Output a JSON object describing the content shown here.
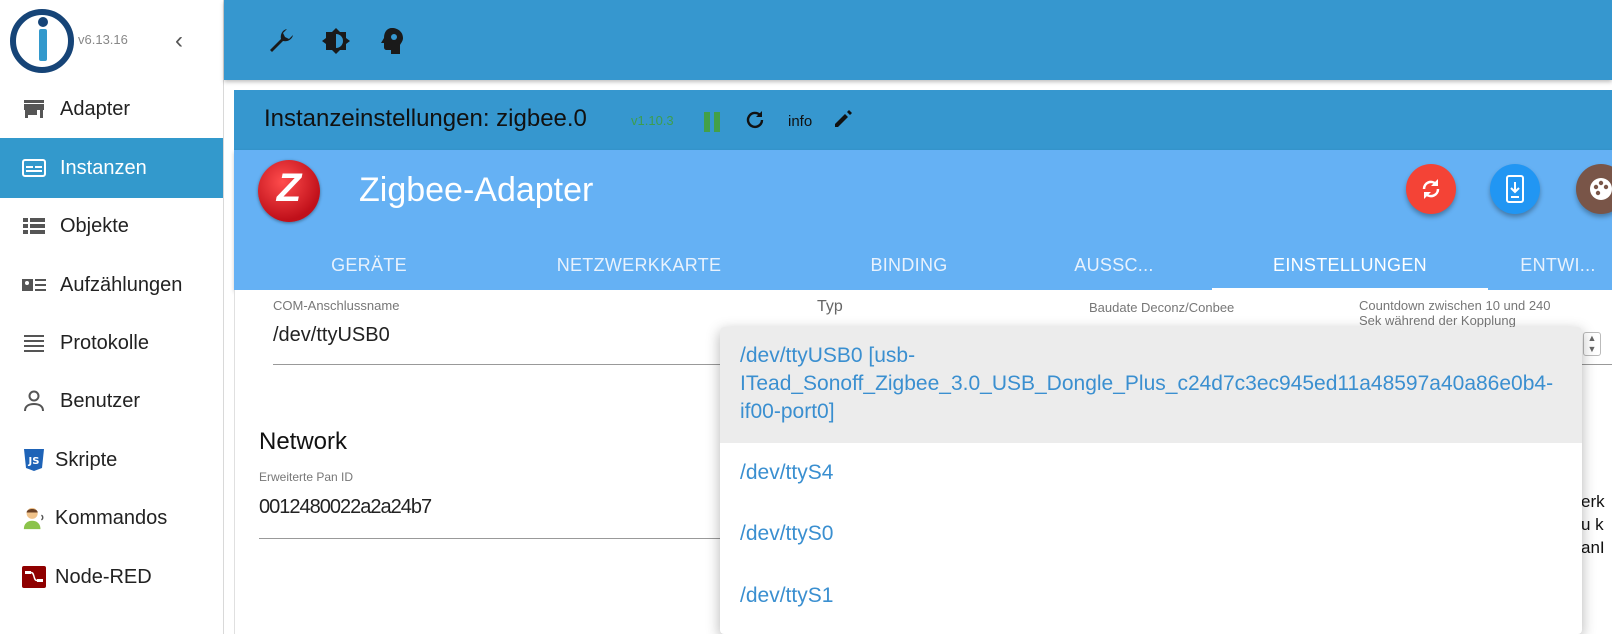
{
  "sidebar": {
    "version": "v6.13.16",
    "items": [
      {
        "label": "Adapter",
        "icon": "store-icon",
        "active": false
      },
      {
        "label": "Instanzen",
        "icon": "instances-icon",
        "active": true
      },
      {
        "label": "Objekte",
        "icon": "list-icon",
        "active": false
      },
      {
        "label": "Aufzählungen",
        "icon": "enum-icon",
        "active": false
      },
      {
        "label": "Protokolle",
        "icon": "log-icon",
        "active": false
      },
      {
        "label": "Benutzer",
        "icon": "user-icon",
        "active": false
      },
      {
        "label": "Skripte",
        "icon": "js-icon",
        "active": false
      },
      {
        "label": "Kommandos",
        "icon": "avatar-icon",
        "active": false
      },
      {
        "label": "Node-RED",
        "icon": "node-red-icon",
        "active": false
      }
    ]
  },
  "toolbar": {
    "icons": [
      "wrench-icon",
      "brightness-icon",
      "expert-mode-icon"
    ]
  },
  "instance": {
    "title": "Instanzeinstellungen: zigbee.0",
    "version": "v1.10.3",
    "info_label": "info"
  },
  "adapter": {
    "title": "Zigbee-Adapter",
    "tabs": [
      "GERÄTE",
      "NETZWERKKARTE",
      "BINDING",
      "AUSSC...",
      "EINSTELLUNGEN",
      "ENTWI..."
    ],
    "active_tab": "EINSTELLUNGEN"
  },
  "form": {
    "com_label": "COM-Anschlussname",
    "com_value": "/dev/ttyUSB0",
    "typ_label": "Typ",
    "baud_label": "Baudate Deconz/Conbee",
    "countdown_label": "Countdown zwischen 10 und 240 Sek während der Kopplung",
    "network_heading": "Network",
    "pan_label": "Erweiterte Pan ID",
    "pan_value": "0012480022a2a24b7",
    "right_clip": "erk\nu k\nanI"
  },
  "dropdown": {
    "options": [
      "/dev/ttyUSB0 [usb-ITead_Sonoff_Zigbee_3.0_USB_Dongle_Plus_c24d7c3ec945ed11a48597a40a86e0b4-if00-port0]",
      "/dev/ttyS4",
      "/dev/ttyS0",
      "/dev/ttyS1"
    ],
    "selected_index": 0
  },
  "colors": {
    "primary": "#3697cf",
    "adapter_header": "#65b1f4",
    "active_nav": "#3399cc",
    "link": "#3a8fd0",
    "fab_red": "#f44336",
    "fab_blue": "#2196f3",
    "fab_brown": "#795548"
  }
}
